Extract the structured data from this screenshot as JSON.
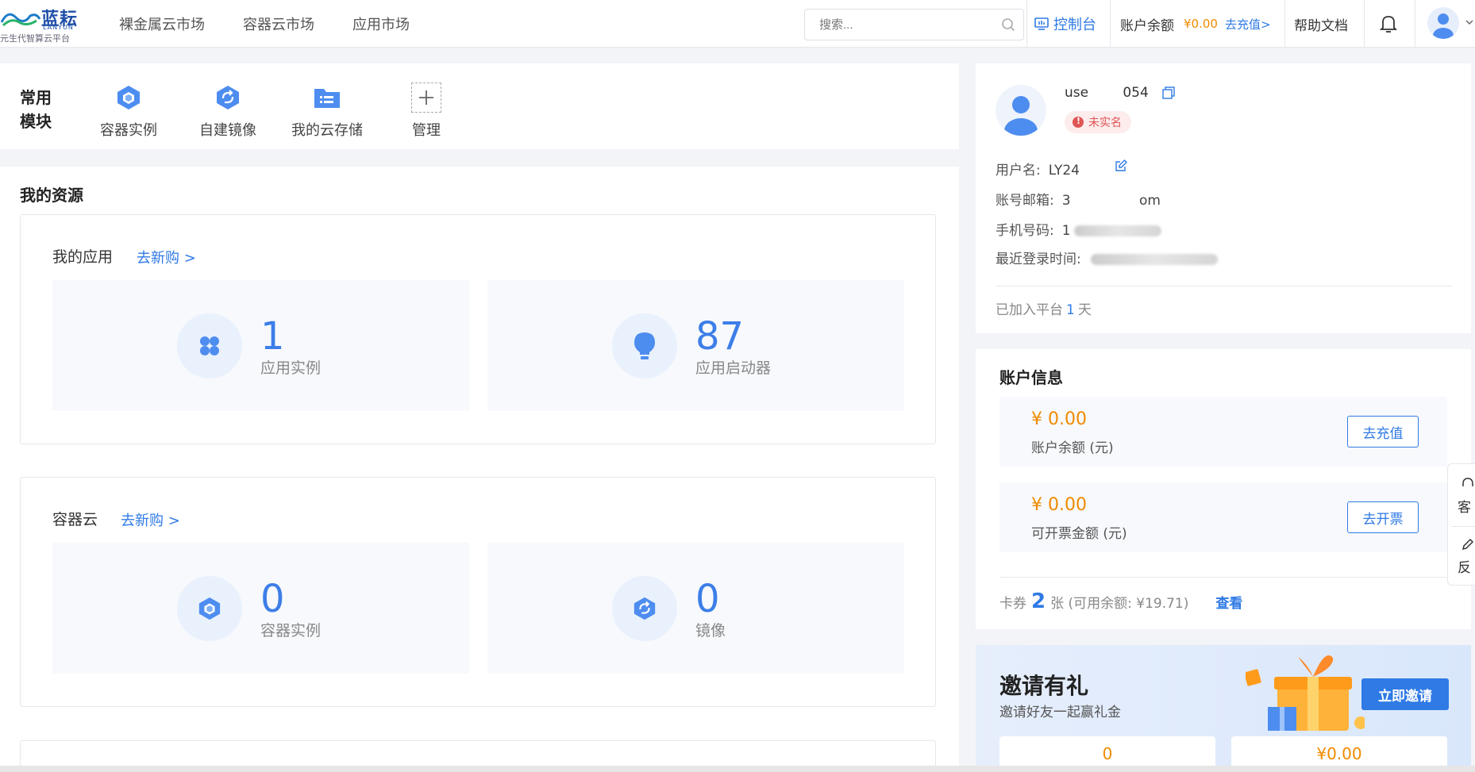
{
  "brand": {
    "name": "蓝耘",
    "name_en": "LANYUN",
    "slogan": "元生代智算云平台"
  },
  "nav": [
    {
      "label": "裸金属云市场"
    },
    {
      "label": "容器云市场"
    },
    {
      "label": "应用市场"
    }
  ],
  "search": {
    "placeholder": "搜索..."
  },
  "topbar": {
    "console": "控制台",
    "balance_label": "账户余额",
    "balance_value": "¥0.00",
    "recharge": "去充值>",
    "help": "帮助文档"
  },
  "quick": {
    "title": "常用模块",
    "items": [
      {
        "label": "容器实例",
        "icon": "cube-icon"
      },
      {
        "label": "自建镜像",
        "icon": "image-sync-icon"
      },
      {
        "label": "我的云存储",
        "icon": "folder-icon"
      },
      {
        "label": "管理",
        "icon": "plus-icon"
      }
    ]
  },
  "resources": {
    "title": "我的资源",
    "apps": {
      "title": "我的应用",
      "link": "去新购 >",
      "stats": [
        {
          "value": "1",
          "label": "应用实例",
          "icon": "app-grid-icon"
        },
        {
          "value": "87",
          "label": "应用启动器",
          "icon": "lightbulb-icon"
        }
      ]
    },
    "containers": {
      "title": "容器云",
      "link": "去新购 >",
      "stats": [
        {
          "value": "0",
          "label": "容器实例",
          "icon": "cube-icon"
        },
        {
          "value": "0",
          "label": "镜像",
          "icon": "image-sync-icon"
        }
      ]
    }
  },
  "profile": {
    "user_id": "use        054",
    "verify_badge": "未实名",
    "username_label": "用户名:",
    "username_value": "LY24",
    "email_label": "账号邮箱:",
    "email_value": "3                om",
    "phone_label": "手机号码:",
    "phone_value": "1",
    "login_label": "最近登录时间:",
    "joined_prefix": "已加入平台",
    "joined_days": "1",
    "joined_suffix": "天"
  },
  "account": {
    "title": "账户信息",
    "balance": {
      "value": "¥ 0.00",
      "label": "账户余额 (元)",
      "button": "去充值"
    },
    "invoice": {
      "value": "¥ 0.00",
      "label": "可开票金额 (元)",
      "button": "去开票"
    },
    "coupon_prefix": "卡券",
    "coupon_count": "2",
    "coupon_suffix": "张 (可用余额: ¥19.71)",
    "coupon_link": "查看"
  },
  "invite": {
    "title": "邀请有礼",
    "subtitle": "邀请好友一起赢礼金",
    "button": "立即邀请",
    "stat_left": "0",
    "stat_right": "¥0.00"
  },
  "sidetab": {
    "service": "客",
    "feedback": "反"
  },
  "colors": {
    "accent": "#2f7ae5",
    "orange": "#f08a00",
    "danger": "#e05555"
  }
}
